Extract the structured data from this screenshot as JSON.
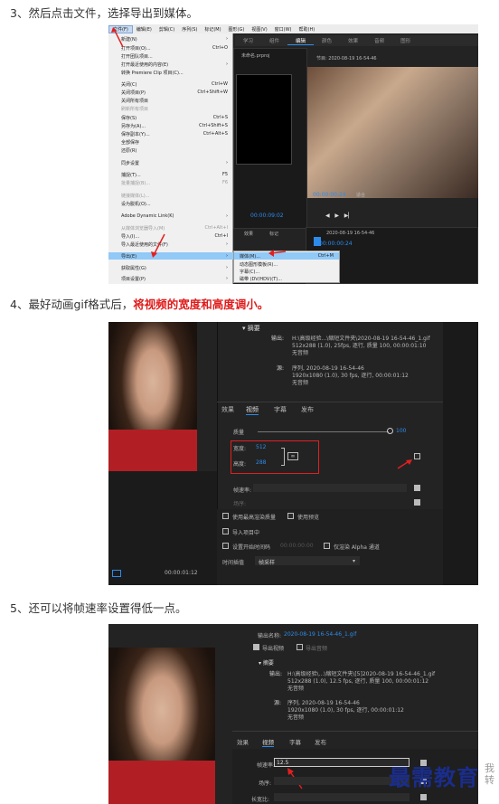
{
  "steps": [
    {
      "text": "3、然后点击文件，选择导出到媒体。"
    },
    {
      "text": "4、最好动画gif格式后，",
      "highlight": "将视频的宽度和高度调小。"
    },
    {
      "text": "5、还可以将帧速率设置得低一点。"
    }
  ],
  "shot1": {
    "menubar": [
      "文件(F)",
      "编辑(E)",
      "剪辑(C)",
      "序列(S)",
      "标记(M)",
      "图形(G)",
      "视图(V)",
      "窗口(W)",
      "帮助(H)"
    ],
    "workspace_tabs": [
      "学习",
      "组件",
      "编辑",
      "颜色",
      "效果",
      "音频",
      "图形"
    ],
    "menu_items": [
      {
        "label": "新建(N)",
        "key": ""
      },
      {
        "label": "打开项目(O)...",
        "key": "Ctrl+O"
      },
      {
        "label": "打开团队项目...",
        "key": ""
      },
      {
        "label": "打开最近使用的内容(E)",
        "key": ""
      },
      {
        "label": "转换 Premiere Clip 项目(C)...",
        "key": ""
      },
      {
        "label": "关闭(C)",
        "key": "Ctrl+W"
      },
      {
        "label": "关闭项目(P)",
        "key": "Ctrl+Shift+W"
      },
      {
        "label": "关闭所有项目",
        "key": ""
      },
      {
        "label": "刷新所有项目",
        "key": ""
      },
      {
        "label": "保存(S)",
        "key": "Ctrl+S"
      },
      {
        "label": "另存为(A)...",
        "key": "Ctrl+Shift+S"
      },
      {
        "label": "保存副本(Y)...",
        "key": "Ctrl+Alt+S"
      },
      {
        "label": "全部保存",
        "key": ""
      },
      {
        "label": "还原(R)",
        "key": ""
      },
      {
        "label": "同步设置",
        "key": ""
      },
      {
        "label": "捕捉(T)...",
        "key": "F5"
      },
      {
        "label": "批量捕捉(B)...",
        "key": "F6"
      },
      {
        "label": "链接媒体(L)...",
        "key": ""
      },
      {
        "label": "设为脱机(O)...",
        "key": ""
      },
      {
        "label": "Adobe Dynamic Link(K)",
        "key": ""
      },
      {
        "label": "从媒体浏览器导入(M)",
        "key": "Ctrl+Alt+I"
      },
      {
        "label": "导入(I)...",
        "key": "Ctrl+I"
      },
      {
        "label": "导入最近使用的文件(F)",
        "key": ""
      },
      {
        "label": "导出(E)",
        "key": ""
      },
      {
        "label": "获取属性(G)",
        "key": ""
      },
      {
        "label": "项目设置(P)",
        "key": ""
      }
    ],
    "submenu_items": [
      {
        "label": "媒体(M)...",
        "key": "Ctrl+M"
      },
      {
        "label": "动态图形模板(R)...",
        "key": ""
      },
      {
        "label": "字幕(C)...",
        "key": ""
      },
      {
        "label": "磁带 (DV/HDV)(T)...",
        "key": ""
      }
    ],
    "source_title": "(无剪辑)",
    "program_title": "节目: 2020-08-19 16-54-46",
    "project_name": "未命名.prproj",
    "timecode_a": "00:00:09:02",
    "timecode_b": "00:00:00:24",
    "timecode_c": "00:00:00:24",
    "fit_label": "适合",
    "seq_tab": "2020-08-19 16-54-46",
    "sub_tabs": [
      "效果",
      "标记"
    ]
  },
  "shot2": {
    "summary_title": "摘要",
    "output_label": "输出:",
    "output_path": "H:\\高级经验...\\缩短文件夹\\2020-08-19 16-54-46_1.gif",
    "output_specs": "512x288 (1.0), 25fps, 逐行, 质量 100, 00:00:01:10",
    "no_audio_1": "无音频",
    "source_label": "源:",
    "source_info": "序列, 2020-08-19 16-54-46",
    "source_specs": "1920x1080 (1.0), 30 fps, 逐行, 00:00:01:12",
    "no_audio_2": "无音频",
    "tabs": [
      "效果",
      "视频",
      "字幕",
      "发布"
    ],
    "quality_label": "质量",
    "quality_value": "100",
    "width_label": "宽度:",
    "width_value": "512",
    "height_label": "高度:",
    "height_value": "288",
    "frame_rate_label": "帧速率:",
    "field_order_label": "场序:",
    "options": [
      "使用最高渲染质量",
      "使用预览",
      "导入项目中",
      "设置开始时间码",
      "仅渲染 Alpha 通道"
    ],
    "start_tc": "00:00:00:00",
    "time_interp_label": "时间插值",
    "time_interp_value": "帧采样",
    "bottom_tc": "00:00:01:12"
  },
  "shot3": {
    "output_name_label": "输出名称:",
    "output_name_value": "2020-08-19 16-54-46_1.gif",
    "export_video": "导出视频",
    "export_audio": "导出音频",
    "summary_title": "摘要",
    "output_label": "输出:",
    "output_path": "H:\\高级经验\\...\\缩短文件夹\\[5]2020-08-19 16-54-46_1.gif",
    "output_specs": "512x288 (1.0), 12.5 fps, 逐行, 质量 100, 00:00:01:12",
    "no_audio_1": "无音频",
    "source_label": "源:",
    "source_info": "序列, 2020-08-19 16-54-46",
    "source_specs": "1920x1080 (1.0), 30 fps, 逐行, 00:00:01:12",
    "no_audio_2": "无音频",
    "tabs": [
      "效果",
      "视频",
      "字幕",
      "发布"
    ],
    "frame_rate_label": "帧速率:",
    "frame_rate_value": "12.5",
    "field_order_label": "场序:",
    "aspect_label": "长宽比:"
  },
  "watermark": {
    "text": "最需教育",
    "side": "我转"
  }
}
